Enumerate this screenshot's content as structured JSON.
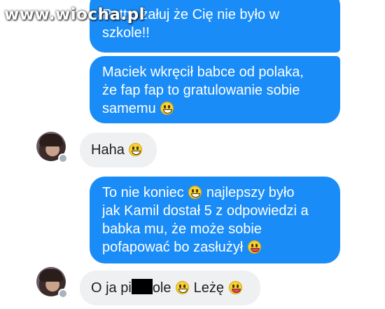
{
  "watermark": {
    "text": "www.wiocha.pl"
  },
  "messages": [
    {
      "sender": "me",
      "lines": [
        "Patty, żałuj że Cię nie było w",
        "szkole!!"
      ]
    },
    {
      "sender": "me",
      "lines": [
        "Maciek wkręcił babce od polaka,",
        "że fap fap to gratulowanie sobie",
        "samemu"
      ],
      "trailing_emoji": "grinning-emoji"
    },
    {
      "sender": "contact",
      "text": "Haha",
      "trailing_emoji": "grinning-emoji"
    },
    {
      "sender": "me",
      "lines": [
        "To nie koniec",
        "najlepszy było",
        "jak Kamil dostał 5 z odpowiedzi a",
        "babka mu, że może sobie",
        "pofapować bo zasłużył"
      ],
      "emojis": [
        "grinning-emoji",
        "tongue-wink-emoji"
      ]
    },
    {
      "sender": "contact",
      "parts": [
        "O ja pi",
        "ole",
        "Leżę"
      ],
      "censored": true,
      "emojis": [
        "grinning-emoji",
        "tongue-wink-emoji"
      ]
    }
  ],
  "colors": {
    "outgoing": "#1a8cf8",
    "incoming": "#eef0f2",
    "emoji": "#f7d135"
  }
}
